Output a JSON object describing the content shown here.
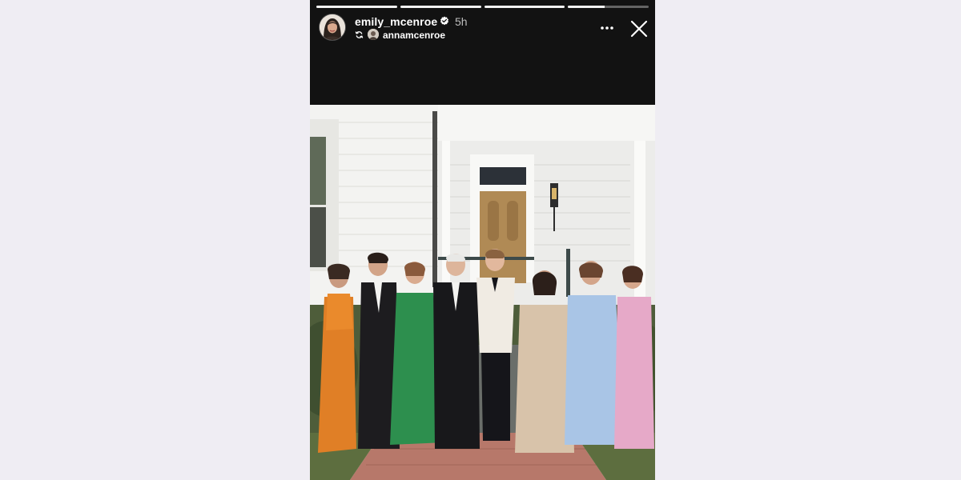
{
  "story": {
    "username": "emily_mcenroe",
    "time": "5h",
    "reshared_from": "annamcenroe",
    "progress": [
      1.0,
      1.0,
      1.0,
      0.45
    ]
  },
  "icons": {
    "verified": "verified-badge-icon",
    "repost": "repost-icon",
    "more": "more-options-icon",
    "close": "close-icon"
  },
  "colors": {
    "story_background": "#121212",
    "page_background": "#efedf3",
    "verified_badge": "#ffffff"
  }
}
